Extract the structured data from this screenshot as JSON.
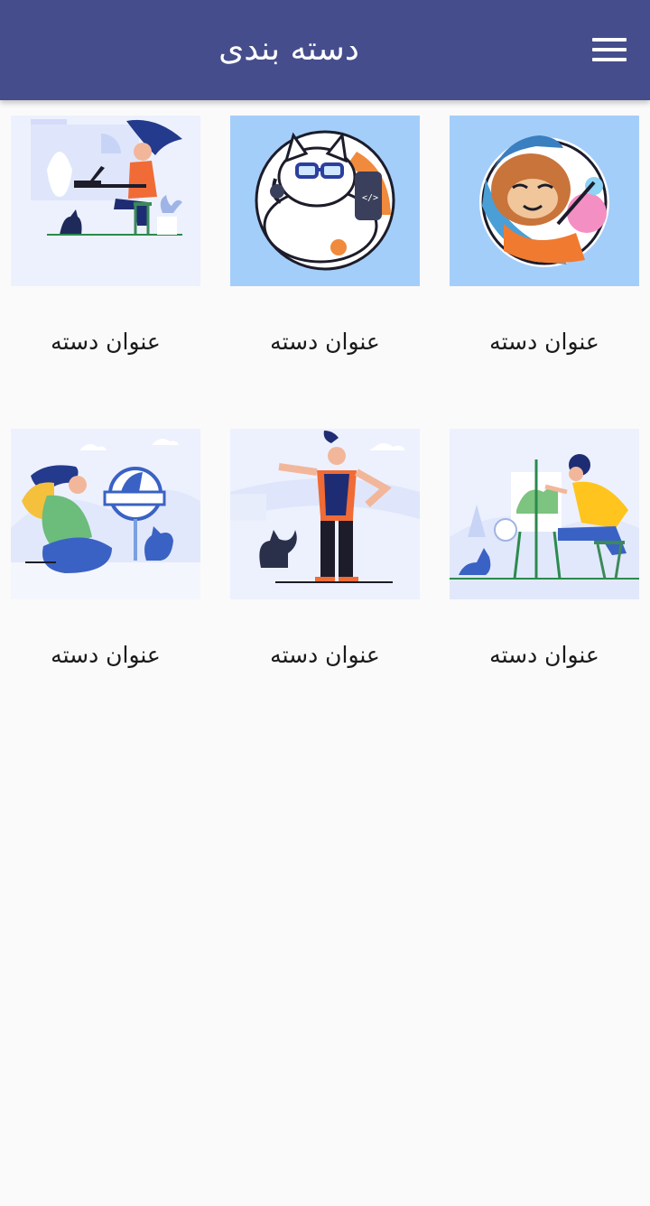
{
  "app_bar": {
    "title": "دسته بندی",
    "menu_icon": "hamburger-menu-icon",
    "background_color": "#454d8c"
  },
  "categories": [
    {
      "label": "عنوان دسته",
      "illustration": "sloth-painter-sticker"
    },
    {
      "label": "عنوان دسته",
      "illustration": "cat-programmer-sticker"
    },
    {
      "label": "عنوان دسته",
      "illustration": "woman-laptop-cat-illustration"
    },
    {
      "label": "عنوان دسته",
      "illustration": "artist-painting-easel-illustration"
    },
    {
      "label": "عنوان دسته",
      "illustration": "man-presenting-cat-illustration"
    },
    {
      "label": "عنوان دسته",
      "illustration": "hiker-sign-cat-illustration"
    }
  ]
}
